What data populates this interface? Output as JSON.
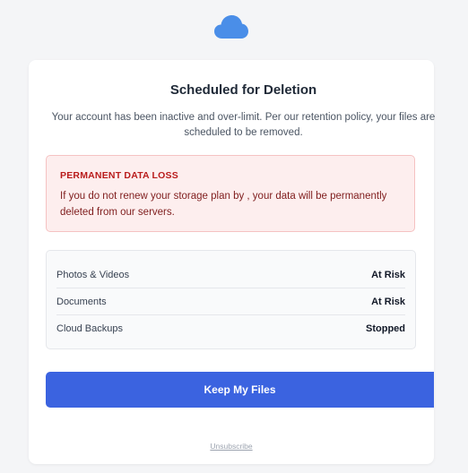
{
  "header": {
    "logo_icon": "cloud-icon",
    "logo_color": "#4a8ee8"
  },
  "card": {
    "title": "Scheduled for Deletion",
    "intro": "Your account has been inactive and over-limit. Per our retention policy, your files are scheduled to be removed."
  },
  "warning": {
    "title": "PERMANENT DATA LOSS",
    "text": "If you do not renew your storage plan by , your data will be permanently deleted from our servers.",
    "background": "#fdeeee",
    "title_color": "#b91c1c"
  },
  "status": {
    "rows": [
      {
        "label": "Photos & Videos",
        "value": "At Risk"
      },
      {
        "label": "Documents",
        "value": "At Risk"
      },
      {
        "label": "Cloud Backups",
        "value": "Stopped"
      }
    ]
  },
  "cta": {
    "label": "Keep My Files",
    "color": "#3b63e0"
  },
  "footer": {
    "unsubscribe_label": "Unsubscribe"
  }
}
